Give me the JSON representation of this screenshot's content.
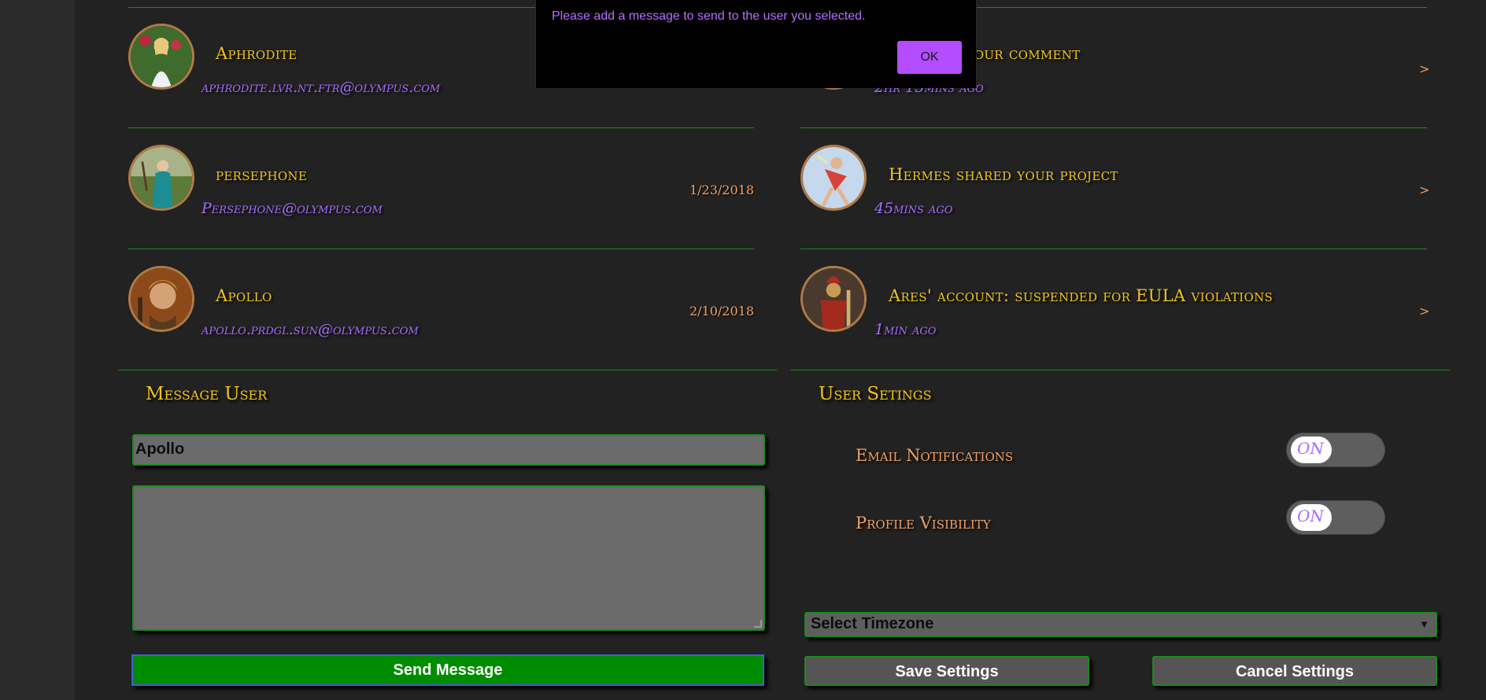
{
  "users": [
    {
      "name": "Aphrodite",
      "email": "aphrodite.lvr.nt.ftr@olympus.com",
      "date": ""
    },
    {
      "name": "persephone",
      "email": "Persephone@olympus.com",
      "date": "1/23/2018"
    },
    {
      "name": "Apollo",
      "email": "apollo.prdgl.sun@olympus.com",
      "date": "2/10/2018"
    }
  ],
  "notifications": [
    {
      "title": "eplied to your comment",
      "time": "2hr 15mins ago",
      "chevron": ">"
    },
    {
      "title": "Hermes shared your project",
      "time": "45mins ago",
      "chevron": ">"
    },
    {
      "title": "Ares' account: suspended for EULA violations",
      "time": "1min ago",
      "chevron": ">"
    }
  ],
  "message_section": {
    "title": "Message User",
    "recipient_value": "Apollo",
    "message_value": "",
    "send_label": "Send Message"
  },
  "settings_section": {
    "title": "User Setings",
    "settings": [
      {
        "label": "Email Notifications",
        "state": "ON"
      },
      {
        "label": "Profile Visibility",
        "state": "ON"
      }
    ],
    "timezone_selected": "Select Timezone",
    "save_label": "Save Settings",
    "cancel_label": "Cancel Settings"
  },
  "modal": {
    "message": "Please add a message to send to the user you selected.",
    "ok_label": "OK"
  },
  "colors": {
    "accent_gold": "#f0c419",
    "accent_purple": "#a66cff",
    "accent_orange": "#f0a062",
    "divider_green": "#1c8a1c",
    "send_green": "#008c00",
    "ok_purple": "#b44cff"
  },
  "icons": {
    "avatar_aphrodite": "avatar-aphrodite-icon",
    "avatar_persephone": "avatar-persephone-icon",
    "avatar_apollo": "avatar-apollo-icon",
    "avatar_hermes": "avatar-hermes-icon",
    "avatar_ares": "avatar-ares-icon"
  }
}
